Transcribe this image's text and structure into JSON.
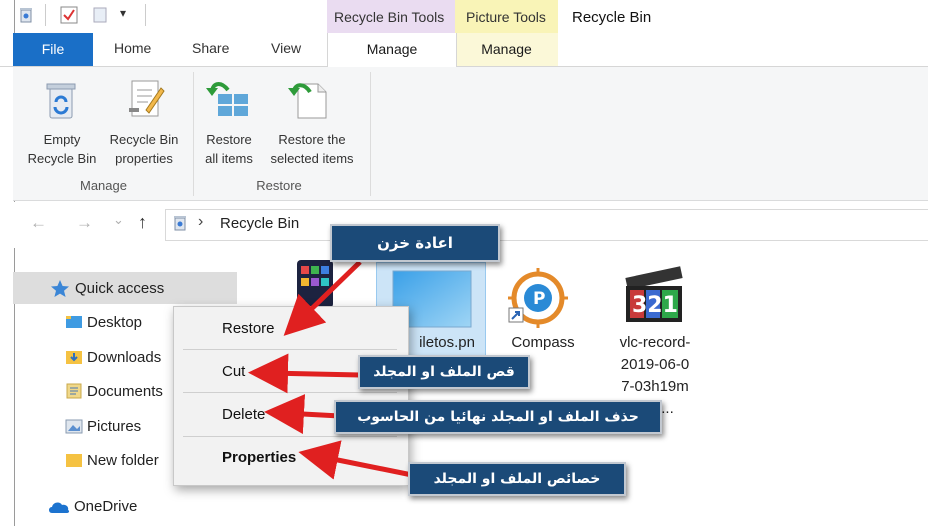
{
  "titlebar": {
    "ctx_tab1": "Recycle Bin Tools",
    "ctx_tab2": "Picture Tools",
    "window_title": "Recycle Bin",
    "qat_dropdown": "▾"
  },
  "tabs": {
    "file": "File",
    "home": "Home",
    "share": "Share",
    "view": "View",
    "manage1": "Manage",
    "manage2": "Manage"
  },
  "ribbon": {
    "empty_line1": "Empty",
    "empty_line2": "Recycle Bin",
    "props_line1": "Recycle Bin",
    "props_line2": "properties",
    "restore_all_line1": "Restore",
    "restore_all_line2": "all items",
    "restore_sel_line1": "Restore the",
    "restore_sel_line2": "selected items",
    "group_manage": "Manage",
    "group_restore": "Restore"
  },
  "address": {
    "back": "←",
    "forward": "→",
    "recent": "⌄",
    "up": "↑",
    "sep": "›",
    "location": "Recycle Bin"
  },
  "nav": {
    "quick_access": "Quick access",
    "items": [
      "Desktop",
      "Downloads",
      "Documents",
      "Pictures",
      "New folder"
    ],
    "onedrive": "OneDrive"
  },
  "files": {
    "partial_name": "iletos.pn",
    "compass": "Compass",
    "vlc_line1": "vlc-record-",
    "vlc_line2": "2019-06-0",
    "vlc_line3": "7-03h19m",
    "vlc_line4": "579..."
  },
  "menu": {
    "restore": "Restore",
    "cut": "Cut",
    "delete": "Delete",
    "properties": "Properties"
  },
  "callouts": {
    "restore": "اعادة خزن",
    "cut": "قص الملف او المجلد",
    "delete": "حذف الملف او المجلد نهائيا من الحاسوب",
    "properties": "خصائص الملف او المجلد"
  },
  "colors": {
    "file_tab": "#1a6fc7",
    "recycle_tools": "#eadcf1",
    "picture_tools": "#f9f4b7",
    "callout_bg": "#1b4a78",
    "arrow": "#e02020"
  }
}
